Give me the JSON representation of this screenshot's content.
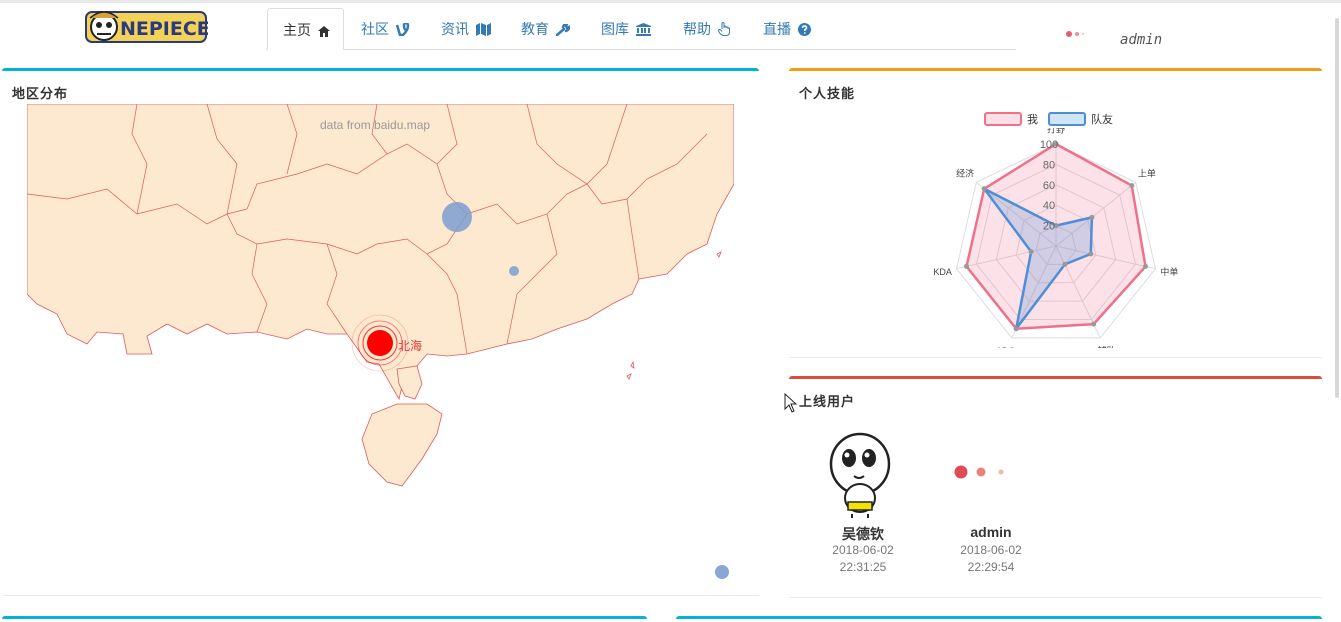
{
  "header": {
    "logo_text": "ONE PIECE",
    "nav": [
      {
        "label": "主页",
        "icon": "home-icon",
        "active": true
      },
      {
        "label": "社区",
        "icon": "vine-icon",
        "active": false
      },
      {
        "label": "资讯",
        "icon": "map-icon",
        "active": false
      },
      {
        "label": "教育",
        "icon": "wrench-icon",
        "active": false
      },
      {
        "label": "图库",
        "icon": "bank-icon",
        "active": false
      },
      {
        "label": "帮助",
        "icon": "hand-pointer-icon",
        "active": false
      },
      {
        "label": "直播",
        "icon": "question-circle-icon",
        "active": false
      }
    ],
    "username": "admin"
  },
  "map_panel": {
    "title": "地区分布",
    "credit": "data from baidu.map",
    "city_label": "北海",
    "colors": {
      "land": "#fde8d0",
      "border": "#e05a5a",
      "highlight": "#ff0000",
      "bubble": "#7b9dd1"
    }
  },
  "skills_panel": {
    "title": "个人技能",
    "chart_data": {
      "type": "radar",
      "axes": [
        "打野",
        "上单",
        "中单",
        "辅助",
        "ADC",
        "KDA",
        "经济"
      ],
      "ticks": [
        20,
        40,
        60,
        80,
        100
      ],
      "rlim": [
        0,
        100
      ],
      "series": [
        {
          "name": "我",
          "values": [
            100,
            95,
            90,
            85,
            90,
            90,
            90
          ],
          "color": "#f0708a"
        },
        {
          "name": "队友",
          "values": [
            20,
            45,
            35,
            20,
            90,
            25,
            90
          ],
          "color": "#4f8ed6"
        }
      ]
    }
  },
  "online_panel": {
    "title": "上线用户",
    "users": [
      {
        "name": "吴德钦",
        "date": "2018-06-02",
        "time": "22:31:25",
        "avatar": "cartoon-avatar-icon"
      },
      {
        "name": "admin",
        "date": "2018-06-02",
        "time": "22:29:54",
        "avatar": "loading-dots-icon"
      }
    ]
  }
}
